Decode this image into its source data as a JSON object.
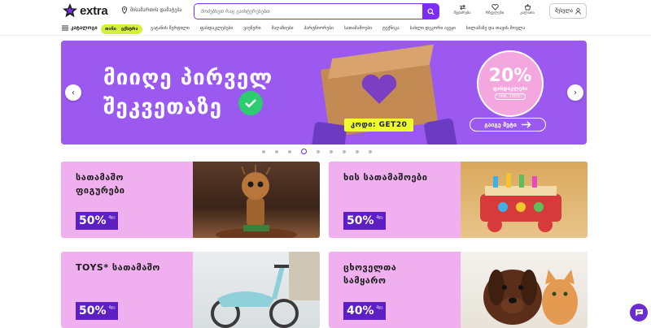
{
  "header": {
    "logo_text": "extra",
    "location": "მისამართის დამატება",
    "search_placeholder": "მოძებნეთ რაც გაინტერესებთ",
    "icons": [
      {
        "label": "შედარება",
        "icon": "compare-icon"
      },
      {
        "label": "რჩეულები",
        "icon": "heart-icon"
      },
      {
        "label": "კალათა",
        "icon": "cart-icon"
      }
    ],
    "login_label": "შესვლა"
  },
  "nav": {
    "all_label": "კატალოგი",
    "deal_label_1": "თანი",
    "deal_label_2": "ექსტრა",
    "items": [
      "გატანის წერტილი",
      "ფასდაკლებები",
      "ვაუჩერი",
      "მაღაზიები",
      "პარტნიორები",
      "სათამაშოები",
      "ტექნიკა",
      "სახლი დეკორი ავეჯი",
      "სილამაზე და თავის მოვლა"
    ]
  },
  "banner": {
    "title_line1": "მიიღე პირველ",
    "title_line2": "შეკვეთაზე",
    "code": "კოდი: GET20",
    "promo_percent": "20%",
    "promo_label": "ფასდაკლება",
    "promo_min": "(მინ. 100₾)",
    "more_label": "გაიგე მეტი"
  },
  "carousel": {
    "dot_count": 9,
    "active_index": 3
  },
  "cards": [
    {
      "title_line1": "სათამაშო",
      "title_line2": "ფიგურები",
      "discount": "50%",
      "prefix": "-მდე"
    },
    {
      "title_line1": "ხის სათამაშოები",
      "title_line2": "",
      "discount": "50%",
      "prefix": "-მდე"
    },
    {
      "title_line1": "TOYS* სათამაშო",
      "title_line2": "",
      "discount": "50%",
      "prefix": "-მდე"
    },
    {
      "title_line1": "ცხოველთა",
      "title_line2": "სამყარო",
      "discount": "40%",
      "prefix": "-მდე"
    }
  ],
  "colors": {
    "brand_purple": "#7b2cf5",
    "banner_bg": "#9b59f0",
    "card_bg": "#f0b0f0",
    "badge_bg": "#5d1fc4",
    "accent_yellow": "#efff2e"
  }
}
